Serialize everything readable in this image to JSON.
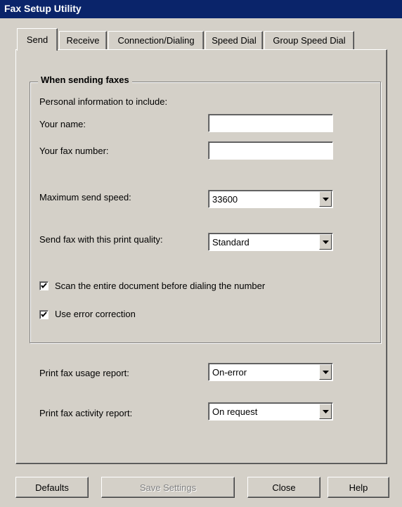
{
  "window": {
    "title": "Fax Setup Utility"
  },
  "tabs": [
    {
      "label": "Send",
      "active": true
    },
    {
      "label": "Receive"
    },
    {
      "label": "Connection/Dialing"
    },
    {
      "label": "Speed Dial"
    },
    {
      "label": "Group Speed Dial"
    }
  ],
  "send": {
    "group_title": "When sending faxes",
    "personal_info_label": "Personal information to include:",
    "name_label": "Your name:",
    "name_value": "",
    "fax_number_label": "Your fax number:",
    "fax_number_value": "",
    "max_speed_label": "Maximum send speed:",
    "max_speed_value": "33600",
    "print_quality_label": "Send fax with this print quality:",
    "print_quality_value": "Standard",
    "scan_label": "Scan the entire document before dialing the number",
    "scan_checked": true,
    "error_correction_label": "Use error correction",
    "error_correction_checked": true,
    "usage_report_label": "Print fax usage report:",
    "usage_report_value": "On-error",
    "activity_report_label": "Print fax activity report:",
    "activity_report_value": "On request"
  },
  "buttons": {
    "defaults": "Defaults",
    "save_settings": "Save Settings",
    "close": "Close",
    "help": "Help"
  },
  "colors": {
    "titlebar": "#0a246a",
    "face": "#d4d0c8"
  },
  "icons": {
    "dropdown": "chevron-down-icon",
    "check": "check-icon"
  }
}
